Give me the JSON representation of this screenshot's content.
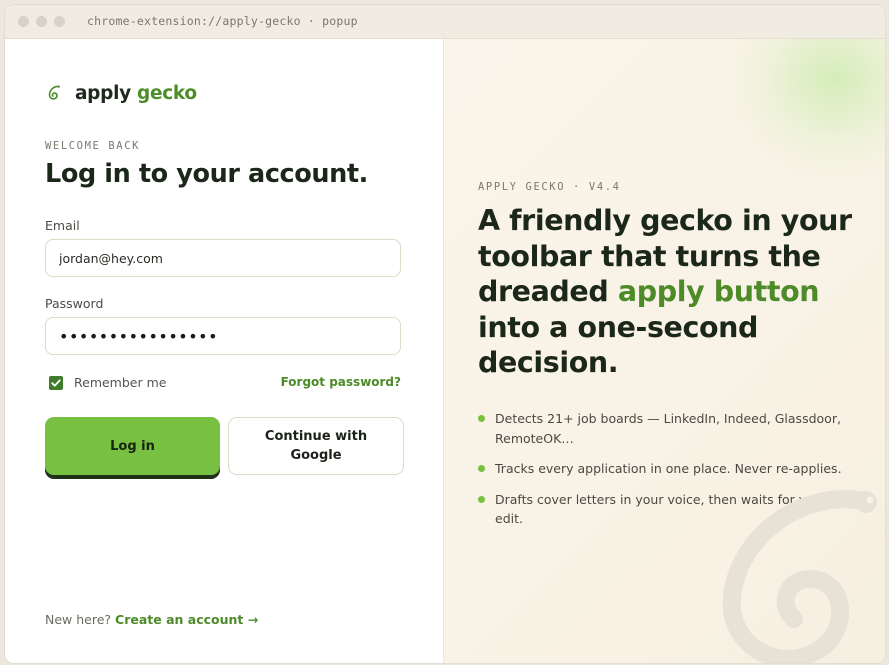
{
  "window": {
    "url": "chrome-extension://apply-gecko · popup"
  },
  "brand": {
    "name_part1": "apply",
    "name_part2": "gecko",
    "accent_color": "#4d8d2a",
    "primary_button_color": "#78c042"
  },
  "login": {
    "eyebrow": "WELCOME BACK",
    "title": "Log in to your account.",
    "email_label": "Email",
    "email_value": "jordan@hey.com",
    "password_label": "Password",
    "password_value": "••••••••••••••••",
    "remember_label": "Remember me",
    "remember_checked": true,
    "forgot_label": "Forgot password?",
    "login_button": "Log in",
    "google_button": "Continue with Google",
    "signup_prompt": "New here?",
    "signup_link": "Create an account →"
  },
  "promo": {
    "eyebrow": "APPLY GECKO · V4.4",
    "headline_before": "A friendly gecko in your toolbar that turns the dreaded ",
    "headline_highlight": "apply button",
    "headline_after": " into a one-second decision.",
    "bullets": [
      "Detects 21+ job boards — LinkedIn, Indeed, Glassdoor, RemoteOK…",
      "Tracks every application in one place. Never re-applies.",
      "Drafts cover letters in your voice, then waits for your edit."
    ]
  },
  "icons": {
    "logo": "gecko-swirl-icon",
    "checkbox": "checkmark-icon",
    "decoration": "gecko-tail-icon"
  }
}
